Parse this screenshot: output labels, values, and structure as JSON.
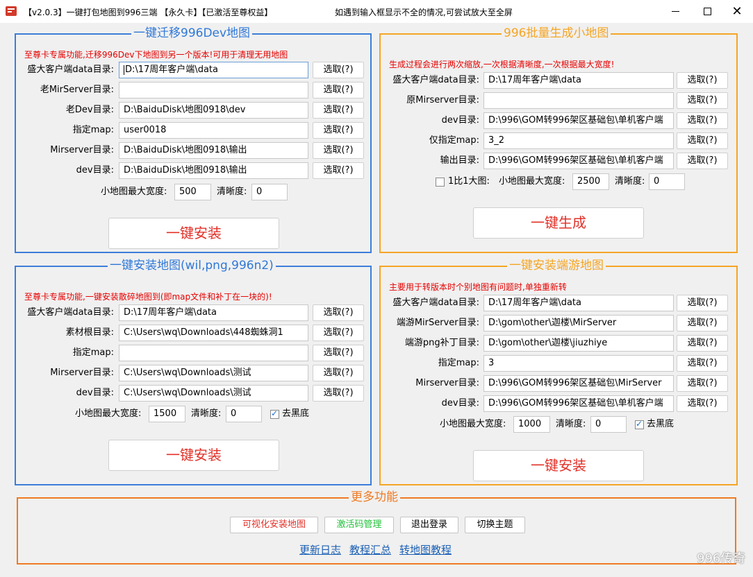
{
  "window": {
    "title": "【v2.0.3】一键打包地图到996三端 【永久卡】【已激活至尊权益】",
    "hint": "如遇到输入框显示不全的情况,可尝试放大至全屏",
    "minimize": "—",
    "maximize": "□",
    "close": "✕"
  },
  "panel_migrate": {
    "legend": "一键迁移996Dev地图",
    "notice": "至尊卡专属功能,迁移996Dev下地图到另一个版本!可用于清理无用地图",
    "rows": [
      {
        "label": "盛大客户端data目录:",
        "value": "D:\\17周年客户端\\data",
        "button": "选取(?)"
      },
      {
        "label": "老MirServer目录:",
        "value": "",
        "button": "选取(?)"
      },
      {
        "label": "老Dev目录:",
        "value": "D:\\BaiduDisk\\地图0918\\dev",
        "button": "选取(?)"
      },
      {
        "label": "指定map:",
        "value": "user0018",
        "button": "选取(?)"
      },
      {
        "label": "Mirserver目录:",
        "value": "D:\\BaiduDisk\\地图0918\\输出",
        "button": "选取(?)"
      },
      {
        "label": "dev目录:",
        "value": "D:\\BaiduDisk\\地图0918\\输出",
        "button": "选取(?)"
      }
    ],
    "width_label": "小地图最大宽度:",
    "width_value": "500",
    "clarity_label": "清晰度:",
    "clarity_value": "0",
    "action": "一键安装"
  },
  "panel_batch": {
    "legend": "996批量生成小地图",
    "notice": "生成过程会进行两次缩放,一次根据清晰度,一次根据最大宽度!",
    "rows": [
      {
        "label": "盛大客户端data目录:",
        "value": "D:\\17周年客户端\\data",
        "button": "选取(?)"
      },
      {
        "label": "原Mirserver目录:",
        "value": "",
        "button": "选取(?)"
      },
      {
        "label": "dev目录:",
        "value": "D:\\996\\GOM转996架区基础包\\单机客户端",
        "button": "选取(?)"
      },
      {
        "label": "仅指定map:",
        "value": "3_2",
        "button": "选取(?)"
      },
      {
        "label": "输出目录:",
        "value": "D:\\996\\GOM转996架区基础包\\单机客户端",
        "button": "选取(?)"
      }
    ],
    "one_to_one_label": "1比1大图:",
    "one_to_one_checked": false,
    "width_label": "小地图最大宽度:",
    "width_value": "2500",
    "clarity_label": "清晰度:",
    "clarity_value": "0",
    "action": "一键生成"
  },
  "panel_install": {
    "legend": "一键安装地图(wil,png,996n2)",
    "notice": "至尊卡专属功能,一键安装散碎地图到(即map文件和补丁在一块的)!",
    "rows": [
      {
        "label": "盛大客户端data目录:",
        "value": "D:\\17周年客户端\\data",
        "button": "选取(?)"
      },
      {
        "label": "素材根目录:",
        "value": "C:\\Users\\wq\\Downloads\\448蜘蛛洞1",
        "button": "选取(?)"
      },
      {
        "label": "指定map:",
        "value": "",
        "button": "选取(?)"
      },
      {
        "label": "Mirserver目录:",
        "value": "C:\\Users\\wq\\Downloads\\测试",
        "button": "选取(?)"
      },
      {
        "label": "dev目录:",
        "value": "C:\\Users\\wq\\Downloads\\测试",
        "button": "选取(?)"
      }
    ],
    "width_label": "小地图最大宽度:",
    "width_value": "1500",
    "clarity_label": "清晰度:",
    "clarity_value": "0",
    "black_label": "去黑底",
    "black_checked": true,
    "action": "一键安装"
  },
  "panel_endtour": {
    "legend": "一键安装端游地图",
    "notice": "主要用于转版本时个别地图有问题时,单独重新转",
    "rows": [
      {
        "label": "盛大客户端data目录:",
        "value": "D:\\17周年客户端\\data",
        "button": "选取(?)"
      },
      {
        "label": "端游MirServer目录:",
        "value": "D:\\gom\\other\\迦楼\\MirServer",
        "button": "选取(?)"
      },
      {
        "label": "端游png补丁目录:",
        "value": "D:\\gom\\other\\迦楼\\jiuzhiye",
        "button": "选取(?)"
      },
      {
        "label": "指定map:",
        "value": "3",
        "button": "选取(?)"
      },
      {
        "label": "Mirserver目录:",
        "value": "D:\\996\\GOM转996架区基础包\\MirServer",
        "button": "选取(?)"
      },
      {
        "label": "dev目录:",
        "value": "D:\\996\\GOM转996架区基础包\\单机客户端",
        "button": "选取(?)"
      }
    ],
    "width_label": "小地图最大宽度:",
    "width_value": "1000",
    "clarity_label": "清晰度:",
    "clarity_value": "0",
    "black_label": "去黑底",
    "black_checked": true,
    "action": "一键安装"
  },
  "panel_more": {
    "legend": "更多功能",
    "buttons": [
      {
        "label": "可视化安装地图",
        "color": "#e23028"
      },
      {
        "label": "激活码管理",
        "color": "#22c03a"
      },
      {
        "label": "退出登录",
        "color": "#000000"
      },
      {
        "label": "切换主题",
        "color": "#000000"
      }
    ],
    "links": [
      "更新日志",
      "教程汇总",
      "转地图教程"
    ]
  },
  "watermark": "996传奇"
}
